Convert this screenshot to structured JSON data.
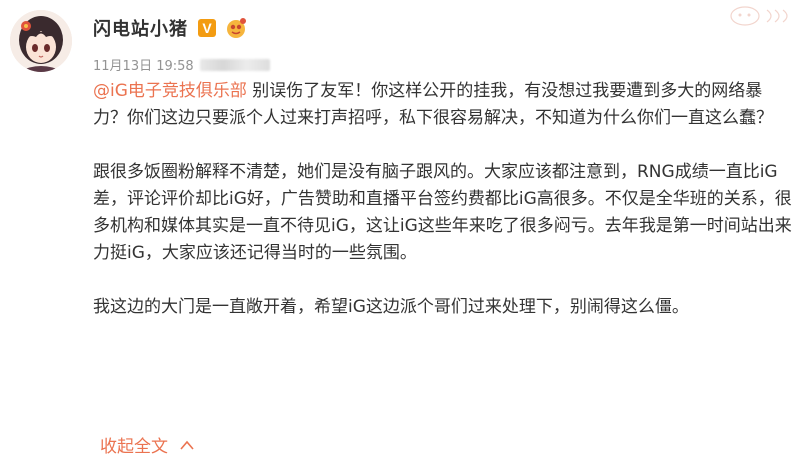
{
  "post": {
    "username": "闪电站小猪",
    "verified_badge": "V",
    "timestamp": "11月13日 19:58",
    "mention": "@iG电子竞技俱乐部",
    "p1_rest": " 别误伤了友军！你这样公开的挂我，有没想过我要遭到多大的网络暴力？你们这边只要派个人过来打声招呼，私下很容易解决，不知道为什么你们一直这么蠢？",
    "p2": "跟很多饭圈粉解释不清楚，她们是没有脑子跟风的。大家应该都注意到，RNG成绩一直比iG差，评论评价却比iG好，广告赞助和直播平台签约费都比iG高很多。不仅是全华班的关系，很多机构和媒体其实是一直不待见iG，这让iG这些年来吃了很多闷亏。去年我是第一时间站出来力挺iG，大家应该还记得当时的一些氛围。",
    "p3": "我这边的大门是一直敞开着，希望iG这边派个哥们过来处理下，别闹得这么僵。",
    "collapse_label": "收起全文"
  },
  "colors": {
    "accent": "#eb7350",
    "text": "#333333",
    "meta": "#939393",
    "vbadge": "#f39c12"
  },
  "icons": [
    "avatar",
    "verified-v-icon",
    "member-badge-icon",
    "watermark-logo",
    "chevron-up-icon"
  ]
}
